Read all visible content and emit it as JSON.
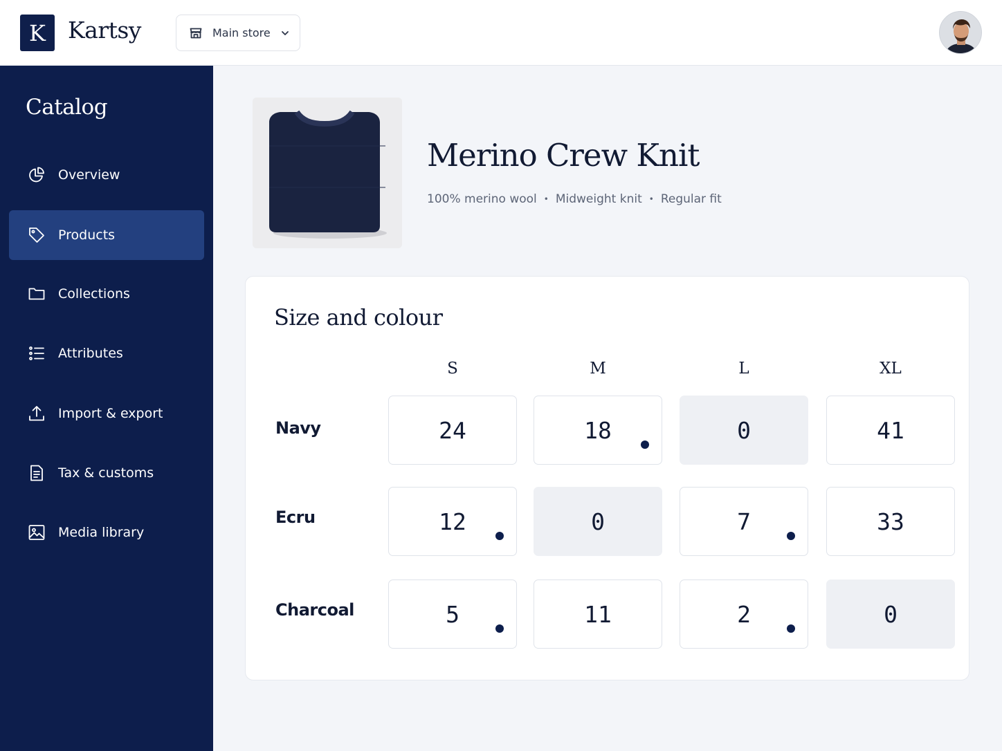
{
  "brand": {
    "initial": "K",
    "name": "Kartsy"
  },
  "store_selector": {
    "label": "Main store"
  },
  "sidebar": {
    "title": "Catalog",
    "items": [
      {
        "label": "Overview",
        "icon": "pie-chart-icon",
        "active": false
      },
      {
        "label": "Products",
        "icon": "tag-icon",
        "active": true
      },
      {
        "label": "Collections",
        "icon": "folder-icon",
        "active": false
      },
      {
        "label": "Attributes",
        "icon": "list-icon",
        "active": false
      },
      {
        "label": "Import & export",
        "icon": "upload-icon",
        "active": false
      },
      {
        "label": "Tax & customs",
        "icon": "document-icon",
        "active": false
      },
      {
        "label": "Media library",
        "icon": "image-icon",
        "active": false
      }
    ]
  },
  "product": {
    "name": "Merino Crew Knit",
    "meta": [
      "100% merino wool",
      "Midweight knit",
      "Regular fit"
    ],
    "separator": "•"
  },
  "variants": {
    "title": "Size and colour",
    "sizes": [
      "S",
      "M",
      "L",
      "XL"
    ],
    "rows": [
      {
        "colour": "Navy",
        "cells": [
          {
            "qty": "24",
            "flag": false
          },
          {
            "qty": "18",
            "flag": true
          },
          {
            "qty": "0",
            "flag": false
          },
          {
            "qty": "41",
            "flag": false
          }
        ]
      },
      {
        "colour": "Ecru",
        "cells": [
          {
            "qty": "12",
            "flag": true
          },
          {
            "qty": "0",
            "flag": false
          },
          {
            "qty": "7",
            "flag": true
          },
          {
            "qty": "33",
            "flag": false
          }
        ]
      },
      {
        "colour": "Charcoal",
        "cells": [
          {
            "qty": "5",
            "flag": true
          },
          {
            "qty": "11",
            "flag": false
          },
          {
            "qty": "2",
            "flag": true
          },
          {
            "qty": "0",
            "flag": false
          }
        ]
      }
    ]
  },
  "colors": {
    "navy": "#0d1e4c",
    "active_nav": "#23407f",
    "zero_cell": "#eef0f4"
  }
}
